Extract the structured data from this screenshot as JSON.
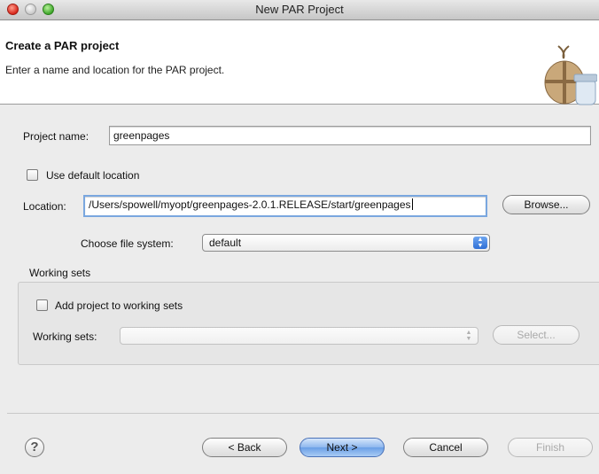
{
  "window": {
    "title": "New PAR Project"
  },
  "header": {
    "title": "Create a PAR project",
    "description": "Enter a name and location for the PAR project."
  },
  "form": {
    "project_name_label": "Project name:",
    "project_name_value": "greenpages",
    "use_default_location_label": "Use default location",
    "use_default_location_checked": false,
    "location_label": "Location:",
    "location_value": "/Users/spowell/myopt/greenpages-2.0.1.RELEASE/start/greenpages",
    "browse_label": "Browse...",
    "file_system_label": "Choose file system:",
    "file_system_value": "default"
  },
  "working_sets": {
    "group_label": "Working sets",
    "add_label": "Add project to working sets",
    "add_checked": false,
    "sets_label": "Working sets:",
    "sets_value": "",
    "select_label": "Select..."
  },
  "footer": {
    "help_glyph": "?",
    "back_label": "< Back",
    "next_label": "Next >",
    "cancel_label": "Cancel",
    "finish_label": "Finish"
  },
  "icons": {
    "close": "close-icon",
    "minimize": "minimize-icon",
    "zoom": "zoom-icon",
    "wizard": "package-jar-icon",
    "help": "help-icon",
    "dropdown": "updown-arrows-icon"
  },
  "colors": {
    "accent_blue": "#6a9fe6",
    "focus_ring": "#7aa7df",
    "close_red": "#d8271c",
    "zoom_green": "#3fa62b"
  }
}
